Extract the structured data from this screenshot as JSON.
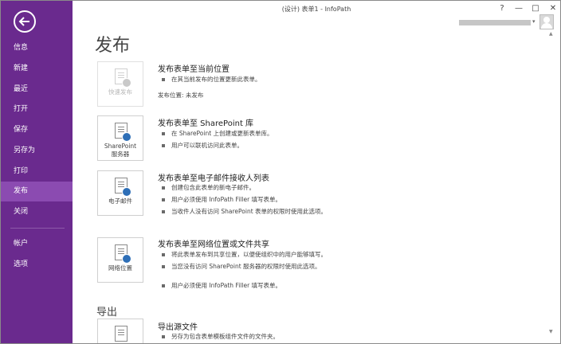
{
  "window": {
    "title": "(设计) 表单1 - InfoPath",
    "help_label": "?",
    "minimize_label": "—",
    "restore_label": "□",
    "close_label": "✕"
  },
  "sidebar": {
    "items": [
      {
        "label": "信息"
      },
      {
        "label": "新建"
      },
      {
        "label": "最近"
      },
      {
        "label": "打开"
      },
      {
        "label": "保存"
      },
      {
        "label": "另存为"
      },
      {
        "label": "打印"
      },
      {
        "label": "发布",
        "active": true
      },
      {
        "label": "关闭"
      },
      {
        "label": "帐户"
      },
      {
        "label": "选项"
      }
    ]
  },
  "main": {
    "page_title": "发布",
    "options": [
      {
        "tile_label": "快速发布",
        "title": "发布表单至当前位置",
        "bullets": [
          "在其当前发布的位置更新此表单。"
        ],
        "extra": "发布位置: 未发布"
      },
      {
        "tile_label_line1": "SharePoint",
        "tile_label_line2": "服务器",
        "title": "发布表单至 SharePoint 库",
        "bullets": [
          "在 SharePoint 上创建或更新表单库。",
          "用户可以联机访问此表单。"
        ]
      },
      {
        "tile_label": "电子邮件",
        "title": "发布表单至电子邮件接收人列表",
        "bullets": [
          "创建包含此表单的新电子邮件。",
          "用户必须使用 InfoPath Filler 填写表单。",
          "当收件人没有访问 SharePoint 表单的权限时使用此选项。"
        ]
      },
      {
        "tile_label": "网络位置",
        "title": "发布表单至网络位置或文件共享",
        "bullets": [
          "将此表单发布到共享位置，以便使组织中的用户能够填写。",
          "当您没有访问 SharePoint 服务器的权限时使用此选项。",
          "用户必须使用 InfoPath Filler 填写表单。"
        ]
      }
    ],
    "export_section_title": "导出",
    "export": {
      "title": "导出源文件",
      "bullets": [
        "另存为包含表单模板组件文件的文件夹。"
      ]
    }
  },
  "colors": {
    "sidebar_bg": "#6a2a8e",
    "sidebar_active": "#8b4bb1",
    "badge_blue": "#2e6fb7"
  },
  "icons": {
    "back": "circle-left-arrow-icon",
    "document": "document-upload-icon",
    "avatar": "user-avatar-icon"
  }
}
